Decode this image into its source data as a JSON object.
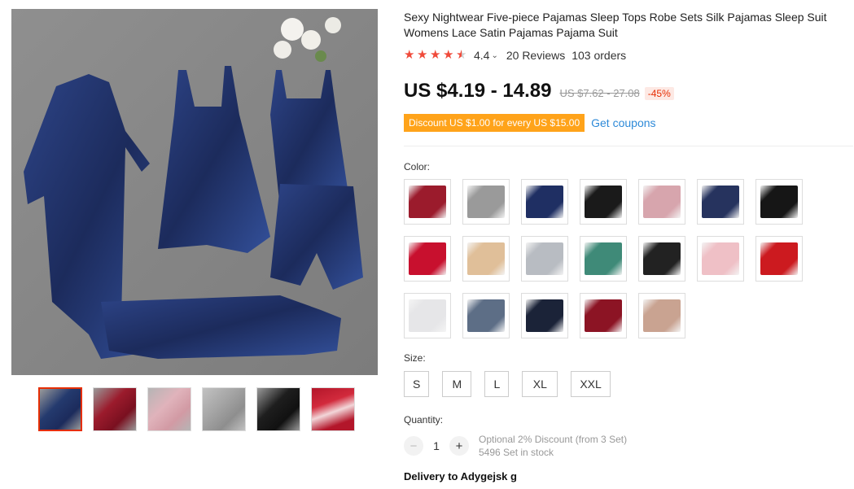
{
  "product": {
    "title": "Sexy Nightwear Five-piece Pajamas Sleep Tops Robe Sets Silk Pajamas Sleep Suit Womens Lace Satin Pajamas Pajama Suit",
    "rating": "4.4",
    "rating_stars": 4.4,
    "reviews": "20 Reviews",
    "orders": "103 orders",
    "price": "US $4.19 - 14.89",
    "old_price": "US $7.62 - 27.08",
    "discount_pct": "-45%",
    "coupon_text": "Discount US $1.00 for every US $15.00",
    "get_coupons": "Get coupons"
  },
  "color": {
    "label": "Color:",
    "swatches": [
      {
        "name": "wine-red-set",
        "color": "#9b1b2c"
      },
      {
        "name": "grey-set",
        "color": "#9a9a9a"
      },
      {
        "name": "navy-set",
        "color": "#1f2f63"
      },
      {
        "name": "black-set",
        "color": "#1a1a1a"
      },
      {
        "name": "pink-set",
        "color": "#d7a5ad"
      },
      {
        "name": "navy-dress",
        "color": "#26335e"
      },
      {
        "name": "black-dress",
        "color": "#161616"
      },
      {
        "name": "red-dress",
        "color": "#c8102e"
      },
      {
        "name": "champagne-dress",
        "color": "#e0bf99"
      },
      {
        "name": "silver-dress",
        "color": "#b8bcc2"
      },
      {
        "name": "green-set",
        "color": "#3f8a78"
      },
      {
        "name": "black-set-2",
        "color": "#222222"
      },
      {
        "name": "light-pink-set",
        "color": "#efc0c6"
      },
      {
        "name": "red-set",
        "color": "#cc1a1f"
      },
      {
        "name": "white-set",
        "color": "#e6e6e8"
      },
      {
        "name": "blue-grey-set",
        "color": "#5d6e86"
      },
      {
        "name": "dark-navy-set",
        "color": "#1b2338"
      },
      {
        "name": "burgundy-set",
        "color": "#8c1424"
      },
      {
        "name": "nude-set",
        "color": "#c9a391"
      }
    ]
  },
  "size": {
    "label": "Size:",
    "options": [
      "S",
      "M",
      "L",
      "XL",
      "XXL"
    ]
  },
  "quantity": {
    "label": "Quantity:",
    "minus": "−",
    "value": "1",
    "plus": "+",
    "optional_discount": "Optional 2% Discount (from 3 Set)",
    "stock": "5496 Set in stock"
  },
  "delivery": {
    "text": "Delivery to Adygejsk g"
  },
  "thumbnails": [
    {
      "name": "navy",
      "color": "#243a6e"
    },
    {
      "name": "wine-red",
      "color": "#9b1b2c"
    },
    {
      "name": "pink",
      "color": "#d9a7b0"
    },
    {
      "name": "grey",
      "color": "#a5a5a5"
    },
    {
      "name": "black",
      "color": "#1e1e1e"
    },
    {
      "name": "red-detail",
      "color": "#b3162a"
    }
  ],
  "colors": {
    "star": "#f04a3a",
    "accent_red": "#e62e04",
    "coupon_bg": "#ffa31a",
    "link_blue": "#2e8ad8"
  }
}
